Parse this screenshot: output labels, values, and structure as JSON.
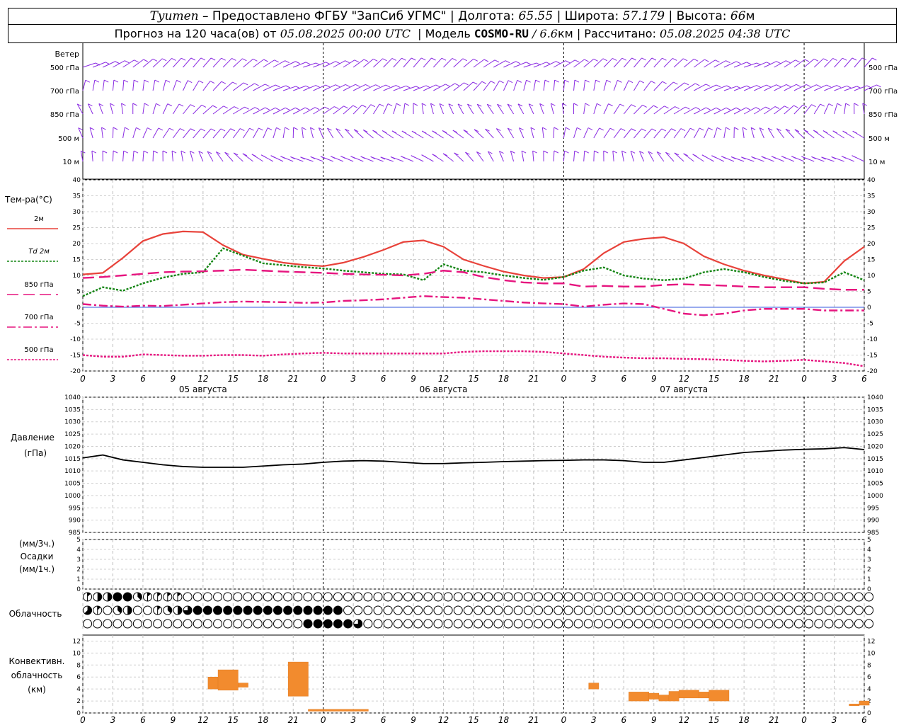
{
  "header": {
    "city": "Tyumen",
    "provider": "– Предоставлено ФГБУ \"ЗапСиб УГМС\" |",
    "lon_label": "Долгота:",
    "lon": "65.55",
    "lat_label": "| Широта:",
    "lat": "57.179",
    "alt_label": "| Высота:",
    "alt": "66",
    "alt_unit": "м",
    "forecast_label": "Прогноз на 120 часа(ов) от",
    "forecast_start": "05.08.2025 00:00 UTC",
    "model_label": "| Модель",
    "model": "COSMO-RU",
    "model_res": "/ 6.6",
    "model_res_unit": "км",
    "computed_label": "| Рассчитано:",
    "computed": "05.08.2025 04:38 UTC"
  },
  "labels": {
    "wind": "Ветер",
    "wind_levels": [
      "500 гПа",
      "700 гПа",
      "850 гПа",
      "500 м",
      "10 м"
    ],
    "temp": "Тем-ра(°C)",
    "pressure": [
      "Давление",
      "(гПа)"
    ],
    "precip": [
      "(мм/3ч.)",
      "Осадки",
      "(мм/1ч.)"
    ],
    "cloud": "Облачность",
    "convective": [
      "Конвективн.",
      "облачность",
      "(км)"
    ],
    "date_labels": [
      "05 августа",
      "06 августа",
      "07 августа"
    ]
  },
  "time": {
    "step_h": 1,
    "hour_ticks": [
      "0",
      "3",
      "6",
      "9",
      "12",
      "15",
      "18",
      "21",
      "0",
      "3",
      "6",
      "9",
      "12",
      "15",
      "18",
      "21",
      "0",
      "3",
      "6",
      "9",
      "12",
      "15",
      "18",
      "21",
      "0",
      "3",
      "6"
    ]
  },
  "chart_data": [
    {
      "type": "line",
      "name": "temperature",
      "ylim": [
        -20,
        40
      ],
      "yticks": [
        -20,
        -15,
        -10,
        -5,
        0,
        5,
        10,
        15,
        20,
        25,
        30,
        35,
        40
      ],
      "x_hours": [
        0,
        2,
        4,
        6,
        8,
        10,
        12,
        14,
        16,
        18,
        20,
        22,
        24,
        26,
        28,
        30,
        32,
        34,
        36,
        38,
        40,
        42,
        44,
        46,
        48,
        50,
        52,
        54,
        56,
        58,
        60,
        62,
        64,
        66,
        68,
        70,
        72,
        74,
        76,
        78
      ],
      "series": [
        {
          "name": "2м",
          "color": "#e8423a",
          "style": "solid",
          "values": [
            10.3,
            10.8,
            15.5,
            20.8,
            23.0,
            23.8,
            23.6,
            19.5,
            16.5,
            15.2,
            14.0,
            13.3,
            12.9,
            14.0,
            15.8,
            18.0,
            20.5,
            21.0,
            19.0,
            15.0,
            13.0,
            11.2,
            10.0,
            9.2,
            9.5,
            12.0,
            17.0,
            20.5,
            21.5,
            22.0,
            20.0,
            16.0,
            13.5,
            11.5,
            10.0,
            8.8,
            7.5,
            8.0,
            14.5,
            19.0
          ]
        },
        {
          "name": "Td 2м",
          "color": "#138513",
          "style": "dot",
          "values": [
            3.5,
            6.3,
            5.2,
            7.5,
            9.3,
            10.5,
            11.0,
            18.5,
            16.2,
            13.8,
            13.2,
            12.6,
            12.2,
            11.5,
            11.0,
            10.5,
            10.3,
            8.5,
            13.5,
            11.5,
            11.0,
            10.0,
            9.2,
            8.6,
            9.5,
            11.5,
            12.5,
            10.0,
            9.0,
            8.5,
            9.0,
            11.0,
            12.0,
            11.0,
            9.5,
            8.3,
            7.5,
            7.8,
            11.0,
            8.5
          ]
        },
        {
          "name": "850 гПа",
          "color": "#e6157f",
          "style": "dash",
          "values": [
            9.2,
            9.5,
            10.0,
            10.5,
            11.0,
            11.2,
            11.3,
            11.5,
            11.8,
            11.5,
            11.2,
            11.0,
            10.8,
            10.5,
            10.3,
            10.2,
            10.0,
            10.5,
            11.5,
            11.0,
            9.5,
            8.5,
            7.8,
            7.5,
            7.5,
            6.5,
            6.7,
            6.5,
            6.5,
            7.0,
            7.2,
            7.0,
            6.8,
            6.5,
            6.3,
            6.3,
            6.3,
            5.8,
            5.5,
            5.5
          ]
        },
        {
          "name": "700 гПа",
          "color": "#e6157f",
          "style": "dashdot",
          "values": [
            1.0,
            0.5,
            0.2,
            0.5,
            0.4,
            0.8,
            1.2,
            1.6,
            1.8,
            1.7,
            1.6,
            1.4,
            1.5,
            2.0,
            2.2,
            2.5,
            3.0,
            3.5,
            3.2,
            3.0,
            2.5,
            2.0,
            1.5,
            1.2,
            1.0,
            0.2,
            0.8,
            1.2,
            1.0,
            -0.5,
            -2.0,
            -2.5,
            -2.0,
            -1.0,
            -0.5,
            -0.5,
            -0.5,
            -1.0,
            -1.0,
            -1.0
          ]
        },
        {
          "name": "500 гПа",
          "color": "#e6157f",
          "style": "dot",
          "values": [
            -15.0,
            -15.5,
            -15.5,
            -14.8,
            -15.0,
            -15.2,
            -15.2,
            -15.0,
            -15.0,
            -15.2,
            -14.8,
            -14.5,
            -14.3,
            -14.5,
            -14.5,
            -14.5,
            -14.5,
            -14.5,
            -14.5,
            -14.0,
            -13.8,
            -13.8,
            -13.8,
            -14.0,
            -14.5,
            -15.0,
            -15.5,
            -15.8,
            -16.0,
            -16.0,
            -16.2,
            -16.3,
            -16.5,
            -16.8,
            -17.0,
            -16.8,
            -16.5,
            -17.0,
            -17.5,
            -18.5
          ]
        }
      ]
    },
    {
      "type": "line",
      "name": "pressure",
      "ylim": [
        985,
        1040
      ],
      "yticks": [
        985,
        990,
        995,
        1000,
        1005,
        1010,
        1015,
        1020,
        1025,
        1030,
        1035,
        1040
      ],
      "x_hours": [
        0,
        2,
        4,
        6,
        8,
        10,
        12,
        14,
        16,
        18,
        20,
        22,
        24,
        26,
        28,
        30,
        32,
        34,
        36,
        38,
        40,
        42,
        44,
        46,
        48,
        50,
        52,
        54,
        56,
        58,
        60,
        62,
        64,
        66,
        68,
        70,
        72,
        74,
        76,
        78
      ],
      "series": [
        {
          "name": "Давление",
          "color": "#000000",
          "style": "solid",
          "values": [
            1015.3,
            1016.5,
            1014.5,
            1013.5,
            1012.5,
            1011.8,
            1011.5,
            1011.5,
            1011.5,
            1012.0,
            1012.5,
            1012.8,
            1013.5,
            1014.0,
            1014.2,
            1014.0,
            1013.5,
            1013.0,
            1013.0,
            1013.3,
            1013.5,
            1013.8,
            1014.0,
            1014.2,
            1014.3,
            1014.5,
            1014.5,
            1014.2,
            1013.5,
            1013.5,
            1014.5,
            1015.5,
            1016.5,
            1017.5,
            1018.0,
            1018.5,
            1018.8,
            1019.0,
            1019.5,
            1018.7
          ]
        }
      ]
    },
    {
      "type": "bar",
      "name": "precipitation",
      "ylim": [
        0,
        5
      ],
      "yticks": [
        0,
        1,
        2,
        3,
        4,
        5
      ],
      "values": []
    },
    {
      "type": "bar",
      "name": "convective_cloud",
      "ylim": [
        0,
        13
      ],
      "yticks": [
        0,
        2,
        4,
        6,
        8,
        10,
        12
      ],
      "blocks": [
        {
          "t0": 12.5,
          "t1": 13.5,
          "bottom": 4.0,
          "top": 6.0
        },
        {
          "t0": 13.5,
          "t1": 15.5,
          "bottom": 3.8,
          "top": 7.2
        },
        {
          "t0": 15.5,
          "t1": 16.5,
          "bottom": 4.3,
          "top": 5.0
        },
        {
          "t0": 20.5,
          "t1": 22.5,
          "bottom": 2.8,
          "top": 8.5
        },
        {
          "t0": 22.5,
          "t1": 28.5,
          "bottom": 0.3,
          "top": 0.6
        },
        {
          "t0": 50.5,
          "t1": 51.5,
          "bottom": 4.0,
          "top": 5.0
        },
        {
          "t0": 54.5,
          "t1": 56.5,
          "bottom": 2.0,
          "top": 3.5
        },
        {
          "t0": 56.5,
          "t1": 57.5,
          "bottom": 2.3,
          "top": 3.3
        },
        {
          "t0": 57.5,
          "t1": 58.5,
          "bottom": 2.0,
          "top": 3.0
        },
        {
          "t0": 58.5,
          "t1": 59.5,
          "bottom": 2.0,
          "top": 3.6
        },
        {
          "t0": 59.5,
          "t1": 61.5,
          "bottom": 2.5,
          "top": 3.8
        },
        {
          "t0": 61.5,
          "t1": 62.5,
          "bottom": 2.5,
          "top": 3.5
        },
        {
          "t0": 62.5,
          "t1": 64.5,
          "bottom": 2.0,
          "top": 3.8
        },
        {
          "t0": 76.5,
          "t1": 77.5,
          "bottom": 1.2,
          "top": 1.5
        },
        {
          "t0": 77.5,
          "t1": 78.5,
          "bottom": 1.3,
          "top": 2.0
        }
      ]
    }
  ],
  "clouds": {
    "note_values": "cloud cover per hour in eighths (0 clear … 8 overcast) for three layers",
    "high": [
      1,
      4,
      4,
      8,
      8,
      3,
      1,
      1,
      1,
      1,
      0,
      0,
      0,
      0,
      0,
      0,
      0,
      0,
      0,
      0,
      0,
      0,
      0,
      0,
      0,
      0,
      0,
      0,
      0,
      0,
      0,
      0,
      0,
      0,
      0,
      0,
      0,
      0,
      0,
      0,
      0,
      0,
      0,
      0,
      0,
      0,
      0,
      0,
      0,
      0,
      0,
      0,
      0,
      0,
      0,
      0,
      0,
      0,
      0,
      0,
      0,
      0,
      0,
      0,
      0,
      0,
      0,
      0,
      0,
      0,
      0,
      0,
      0,
      0,
      0,
      0,
      0,
      0,
      0
    ],
    "middle": [
      5,
      1,
      0,
      3,
      4,
      0,
      0,
      1,
      3,
      4,
      6,
      8,
      8,
      8,
      8,
      8,
      8,
      8,
      8,
      8,
      8,
      8,
      8,
      8,
      8,
      8,
      0,
      0,
      0,
      0,
      0,
      0,
      0,
      0,
      0,
      0,
      0,
      0,
      0,
      0,
      0,
      0,
      0,
      0,
      0,
      0,
      0,
      0,
      0,
      0,
      0,
      0,
      0,
      0,
      0,
      0,
      0,
      0,
      0,
      0,
      0,
      0,
      0,
      0,
      0,
      0,
      0,
      0,
      0,
      0,
      0,
      0,
      0,
      0,
      0,
      0,
      0,
      0,
      0
    ],
    "low": [
      0,
      0,
      0,
      0,
      0,
      0,
      0,
      0,
      0,
      0,
      0,
      0,
      0,
      0,
      0,
      0,
      0,
      0,
      0,
      0,
      0,
      0,
      8,
      8,
      8,
      8,
      8,
      6,
      0,
      0,
      0,
      0,
      0,
      0,
      0,
      0,
      0,
      0,
      0,
      0,
      0,
      0,
      0,
      0,
      0,
      0,
      0,
      0,
      0,
      0,
      0,
      0,
      0,
      0,
      0,
      0,
      0,
      0,
      0,
      0,
      0,
      0,
      0,
      0,
      0,
      0,
      0,
      0,
      0,
      0,
      0,
      0,
      0,
      0,
      0,
      0,
      0,
      0,
      0
    ]
  }
}
